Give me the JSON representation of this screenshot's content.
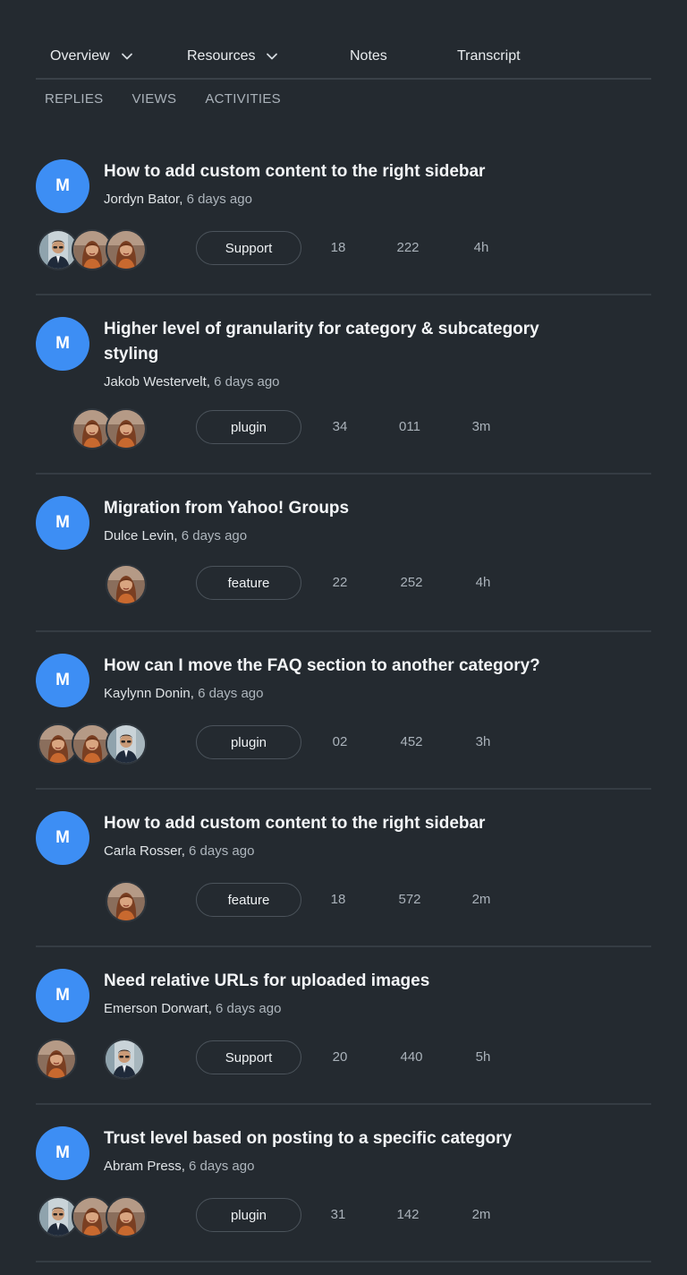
{
  "nav": {
    "overview": "Overview",
    "resources": "Resources",
    "notes": "Notes",
    "transcript": "Transcript"
  },
  "subtabs": [
    "REPLIES",
    "VIEWS",
    "ACTIVITIES"
  ],
  "colors": {
    "background": "#242a30",
    "accent": "#3d8ef4",
    "divider": "#353c43"
  },
  "topics": [
    {
      "initial": "M",
      "title": "How to add custom content to the right sidebar",
      "author": "Jordyn Bator,",
      "ago": "6 days ago",
      "tag": "Support",
      "replies": "18",
      "views": "222",
      "activity": "4h",
      "participants": [
        "man-avatar",
        "woman-avatar",
        "woman-avatar"
      ]
    },
    {
      "initial": "M",
      "title": "Higher level of granularity for category & subcategory styling",
      "author": "Jakob Westervelt,",
      "ago": "6 days ago",
      "tag": "plugin",
      "replies": "34",
      "views": "011",
      "activity": "3m",
      "participants": [
        "woman-avatar",
        "woman-avatar"
      ]
    },
    {
      "initial": "M",
      "title": "Migration from Yahoo! Groups",
      "author": "Dulce Levin,",
      "ago": "6 days ago",
      "tag": "feature",
      "replies": "22",
      "views": "252",
      "activity": "4h",
      "participants": [
        "woman-avatar"
      ]
    },
    {
      "initial": "M",
      "title": "How can I move the FAQ section to another category?",
      "author": "Kaylynn Donin,",
      "ago": "6 days ago",
      "tag": "plugin",
      "replies": "02",
      "views": "452",
      "activity": "3h",
      "participants": [
        "woman-avatar",
        "woman-avatar",
        "man-avatar"
      ]
    },
    {
      "initial": "M",
      "title": "How to add custom content to the right sidebar",
      "author": "Carla Rosser,",
      "ago": "6 days ago",
      "tag": "feature",
      "replies": "18",
      "views": "572",
      "activity": "2m",
      "participants": [
        "woman-avatar"
      ]
    },
    {
      "initial": "M",
      "title": "Need relative URLs for uploaded images",
      "author": "Emerson Dorwart,",
      "ago": "6 days ago",
      "tag": "Support",
      "replies": "20",
      "views": "440",
      "activity": "5h",
      "participants": [
        "woman-avatar",
        "man-avatar"
      ]
    },
    {
      "initial": "M",
      "title": "Trust level based on posting to a specific category",
      "author": "Abram Press,",
      "ago": "6 days ago",
      "tag": "plugin",
      "replies": "31",
      "views": "142",
      "activity": "2m",
      "participants": [
        "man-avatar",
        "woman-avatar",
        "woman-avatar"
      ]
    }
  ]
}
